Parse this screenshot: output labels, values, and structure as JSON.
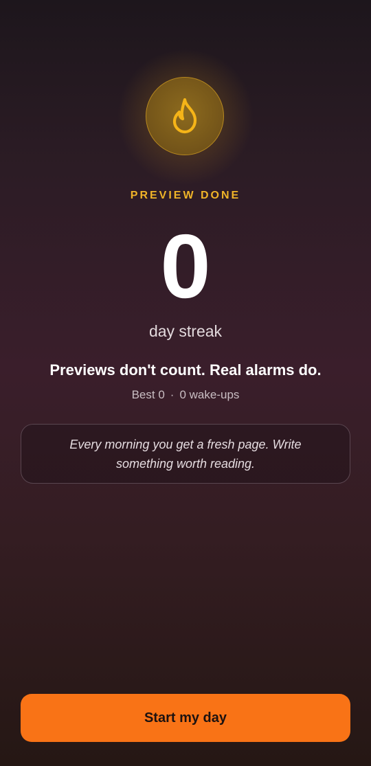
{
  "streak": {
    "eyebrow": "PREVIEW DONE",
    "count": "0",
    "unit_label": "day streak",
    "icon": "flame-icon"
  },
  "message": {
    "headline": "Previews don't count. Real alarms do."
  },
  "stats": {
    "best": "Best 0",
    "separator": "·",
    "wakeups": "0 wake-ups"
  },
  "quote": {
    "text": "Every morning you get a fresh page. Write something worth reading."
  },
  "cta": {
    "label": "Start my day"
  },
  "colors": {
    "accent_gold": "#f0b428",
    "cta_orange": "#f97316"
  }
}
